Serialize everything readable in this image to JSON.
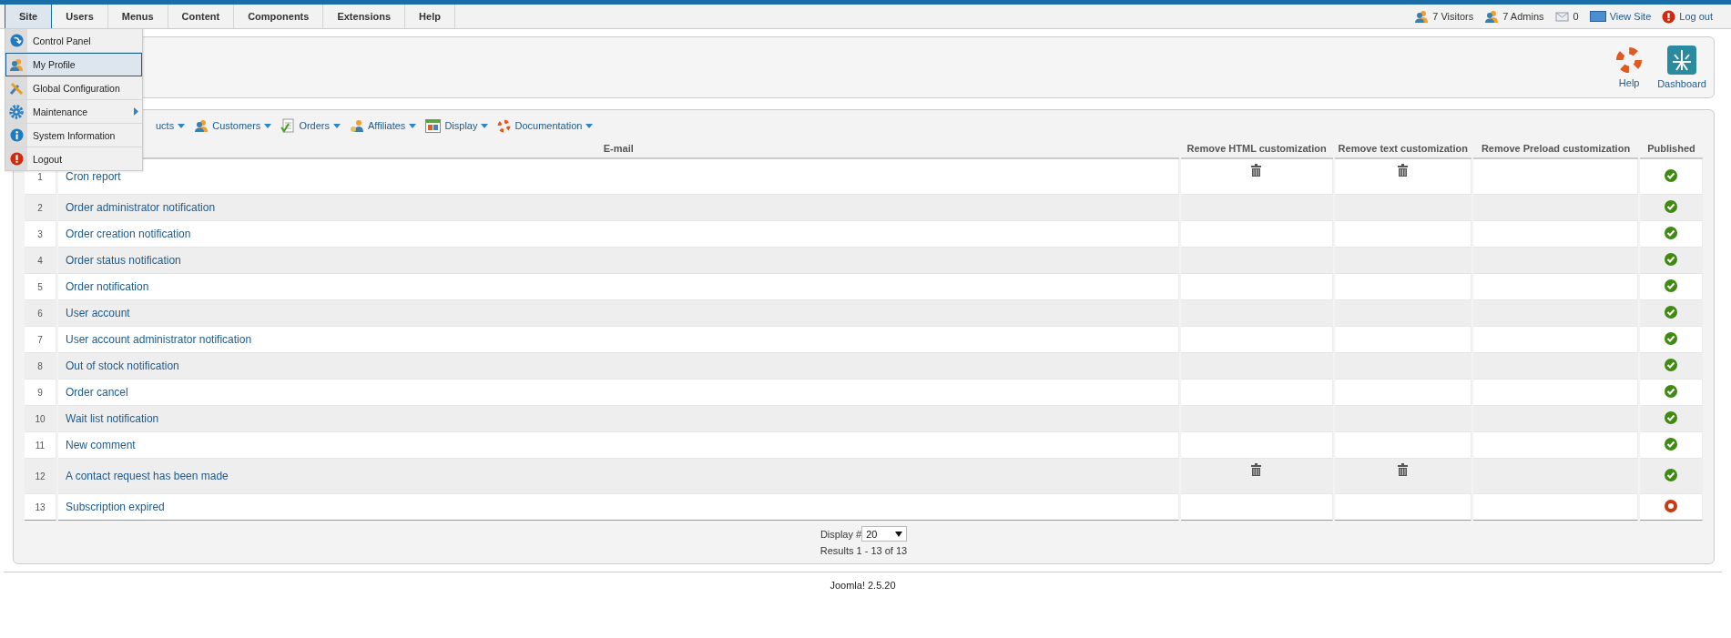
{
  "menubar": [
    {
      "label": "Site",
      "selected": true
    },
    {
      "label": "Users",
      "selected": false
    },
    {
      "label": "Menus",
      "selected": false
    },
    {
      "label": "Content",
      "selected": false
    },
    {
      "label": "Components",
      "selected": false
    },
    {
      "label": "Extensions",
      "selected": false
    },
    {
      "label": "Help",
      "selected": false
    }
  ],
  "status": [
    {
      "kind": "visitors",
      "label": "7 Visitors"
    },
    {
      "kind": "admins",
      "label": "7 Admins"
    },
    {
      "kind": "messages",
      "label": "0"
    },
    {
      "kind": "view",
      "label": "View Site"
    },
    {
      "kind": "logout",
      "label": "Log out"
    }
  ],
  "site_menu": [
    {
      "kind": "panel",
      "label": "Control Panel",
      "selected": false,
      "submenu": false
    },
    {
      "kind": "profile",
      "label": "My Profile",
      "selected": true,
      "submenu": false
    },
    {
      "kind": "config",
      "label": "Global Configuration",
      "selected": false,
      "submenu": false
    },
    {
      "kind": "maintenance",
      "label": "Maintenance",
      "selected": false,
      "submenu": true
    },
    {
      "kind": "info",
      "label": "System Information",
      "selected": false,
      "submenu": false
    },
    {
      "kind": "logout",
      "label": "Logout",
      "selected": false,
      "submenu": false
    }
  ],
  "header_buttons": [
    {
      "kind": "help",
      "label": "Help"
    },
    {
      "kind": "dashboard",
      "label": "Dashboard"
    }
  ],
  "toolbar": [
    {
      "kind": "none",
      "label": "ucts"
    },
    {
      "kind": "customers",
      "label": "Customers"
    },
    {
      "kind": "orders",
      "label": "Orders"
    },
    {
      "kind": "affiliates",
      "label": "Affiliates"
    },
    {
      "kind": "display",
      "label": "Display"
    },
    {
      "kind": "documentation",
      "label": "Documentation"
    }
  ],
  "table": {
    "columns": [
      "E-mail",
      "Remove HTML customization",
      "Remove text customization",
      "Remove Preload customization",
      "Published"
    ],
    "rows": [
      {
        "number": "1",
        "email": "Cron report",
        "html_removable": true,
        "text_removable": true,
        "published": true
      },
      {
        "number": "2",
        "email": "Order administrator notification",
        "html_removable": false,
        "text_removable": false,
        "published": true
      },
      {
        "number": "3",
        "email": "Order creation notification",
        "html_removable": false,
        "text_removable": false,
        "published": true
      },
      {
        "number": "4",
        "email": "Order status notification",
        "html_removable": false,
        "text_removable": false,
        "published": true
      },
      {
        "number": "5",
        "email": "Order notification",
        "html_removable": false,
        "text_removable": false,
        "published": true
      },
      {
        "number": "6",
        "email": "User account",
        "html_removable": false,
        "text_removable": false,
        "published": true
      },
      {
        "number": "7",
        "email": "User account administrator notification",
        "html_removable": false,
        "text_removable": false,
        "published": true
      },
      {
        "number": "8",
        "email": "Out of stock notification",
        "html_removable": false,
        "text_removable": false,
        "published": true
      },
      {
        "number": "9",
        "email": "Order cancel",
        "html_removable": false,
        "text_removable": false,
        "published": true
      },
      {
        "number": "10",
        "email": "Wait list notification",
        "html_removable": false,
        "text_removable": false,
        "published": true
      },
      {
        "number": "11",
        "email": "New comment",
        "html_removable": false,
        "text_removable": false,
        "published": true
      },
      {
        "number": "12",
        "email": "A contact request has been made",
        "html_removable": true,
        "text_removable": true,
        "published": true
      },
      {
        "number": "13",
        "email": "Subscription expired",
        "html_removable": false,
        "text_removable": false,
        "published": false
      }
    ]
  },
  "pagination": {
    "label": "Display #",
    "value": "20",
    "results": "Results 1 - 13 of 13"
  },
  "footer": {
    "version": "Joomla! 2.5.20"
  }
}
